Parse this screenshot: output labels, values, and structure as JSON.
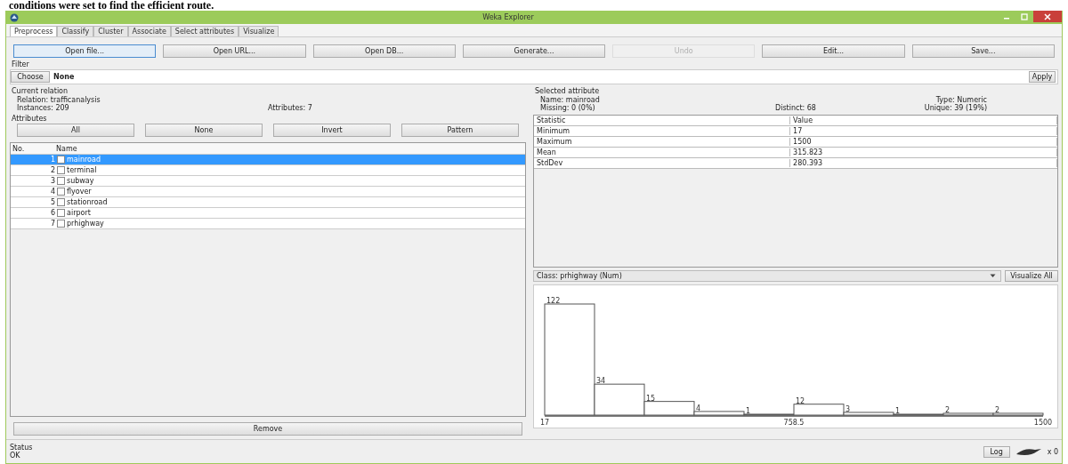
{
  "document_text": "conditions were set to find the efficient route.",
  "window": {
    "title": "Weka Explorer"
  },
  "tabs": [
    {
      "label": "Preprocess",
      "selected": true
    },
    {
      "label": "Classify",
      "selected": false
    },
    {
      "label": "Cluster",
      "selected": false
    },
    {
      "label": "Associate",
      "selected": false
    },
    {
      "label": "Select attributes",
      "selected": false
    },
    {
      "label": "Visualize",
      "selected": false
    }
  ],
  "toolbar_buttons": [
    {
      "label": "Open file...",
      "focused": true,
      "disabled": false
    },
    {
      "label": "Open URL...",
      "focused": false,
      "disabled": false
    },
    {
      "label": "Open DB...",
      "focused": false,
      "disabled": false
    },
    {
      "label": "Generate...",
      "focused": false,
      "disabled": false
    },
    {
      "label": "Undo",
      "focused": false,
      "disabled": true
    },
    {
      "label": "Edit...",
      "focused": false,
      "disabled": false
    },
    {
      "label": "Save...",
      "focused": false,
      "disabled": false
    }
  ],
  "filter": {
    "title": "Filter",
    "choose": "Choose",
    "value": "None",
    "apply": "Apply"
  },
  "current_relation": {
    "title": "Current relation",
    "relation": "Relation: trafficanalysis",
    "instances": "Instances: 209",
    "attributes": "Attributes: 7"
  },
  "attributes": {
    "title": "Attributes",
    "buttons": [
      "All",
      "None",
      "Invert",
      "Pattern"
    ],
    "columns": [
      "No.",
      "Name"
    ],
    "rows": [
      {
        "no": "1",
        "name": "mainroad",
        "checked": false,
        "selected": true
      },
      {
        "no": "2",
        "name": "terminal",
        "checked": false,
        "selected": false
      },
      {
        "no": "3",
        "name": "subway",
        "checked": false,
        "selected": false
      },
      {
        "no": "4",
        "name": "flyover",
        "checked": false,
        "selected": false
      },
      {
        "no": "5",
        "name": "stationroad",
        "checked": false,
        "selected": false
      },
      {
        "no": "6",
        "name": "airport",
        "checked": false,
        "selected": false
      },
      {
        "no": "7",
        "name": "prhighway",
        "checked": false,
        "selected": false
      }
    ],
    "remove": "Remove"
  },
  "selected_attribute": {
    "title": "Selected attribute",
    "name": "Name: mainroad",
    "missing": "Missing: 0 (0%)",
    "distinct": "Distinct: 68",
    "type": "Type: Numeric",
    "unique": "Unique: 39 (19%)"
  },
  "statistics": {
    "columns": [
      "Statistic",
      "Value"
    ],
    "rows": [
      [
        "Minimum",
        "17"
      ],
      [
        "Maximum",
        "1500"
      ],
      [
        "Mean",
        "315.823"
      ],
      [
        "StdDev",
        "280.393"
      ]
    ]
  },
  "class_selector": {
    "value": "Class: prhighway (Num)",
    "button": "Visualize All"
  },
  "histogram": {
    "bar_labels": [
      "122",
      "34",
      "15",
      "4",
      "1",
      "12",
      "3",
      "1",
      "2",
      "2"
    ],
    "axis_labels": [
      "17",
      "758.5",
      "1500"
    ]
  },
  "status": {
    "title": "Status",
    "text": "OK",
    "log": "Log",
    "count": "x 0"
  }
}
